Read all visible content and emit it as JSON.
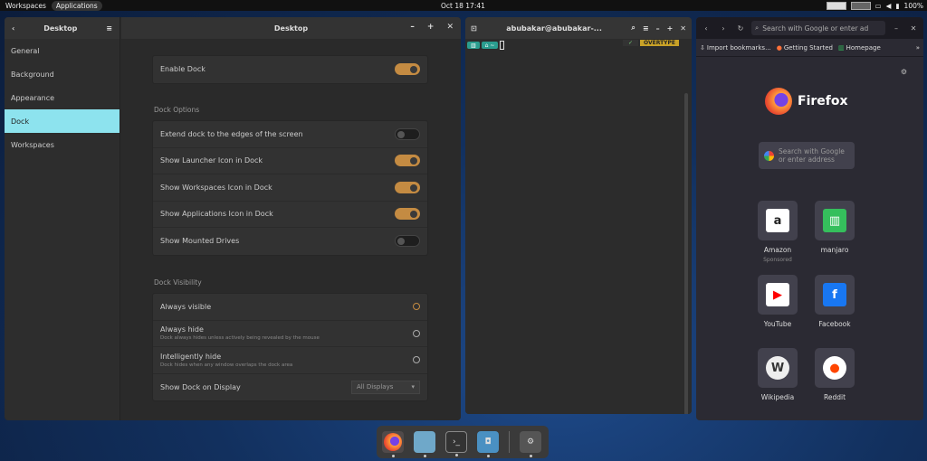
{
  "topbar": {
    "workspaces": "Workspaces",
    "applications": "Applications",
    "clock": "Oct 18  17:41",
    "battery": "100%"
  },
  "settings": {
    "sidebar_title": "Desktop",
    "sidebar": [
      "General",
      "Background",
      "Appearance",
      "Dock",
      "Workspaces"
    ],
    "title": "Desktop",
    "enable_dock": "Enable Dock",
    "dock_options_title": "Dock Options",
    "dock_options": [
      {
        "label": "Extend dock to the edges of the screen",
        "on": false
      },
      {
        "label": "Show Launcher Icon in Dock",
        "on": true
      },
      {
        "label": "Show Workspaces Icon in Dock",
        "on": true
      },
      {
        "label": "Show Applications Icon in Dock",
        "on": true
      },
      {
        "label": "Show Mounted Drives",
        "on": false
      }
    ],
    "visibility_title": "Dock Visibility",
    "always_visible": "Always visible",
    "always_hide": "Always hide",
    "always_hide_sub": "Dock always hides unless actively being revealed by the mouse",
    "intelligently_hide": "Intelligently hide",
    "intelligently_hide_sub": "Dock hides when any window overlaps the dock area",
    "show_on_display": "Show Dock on Display",
    "display_value": "All Displays"
  },
  "terminal": {
    "title": "abubakar@abubakar-...",
    "overtype": "OVERTYPE"
  },
  "firefox": {
    "url_placeholder": "Search with Google or enter ad",
    "bookmarks": [
      "Import bookmarks...",
      "Getting Started",
      "Homepage"
    ],
    "brand": "Firefox",
    "search_placeholder": "Search with Google or enter address",
    "tiles": [
      {
        "name": "Amazon",
        "sub": "Sponsored",
        "icon": "a",
        "color": "#fff",
        "fg": "#222"
      },
      {
        "name": "manjaro",
        "icon": "m",
        "color": "#35bf5c",
        "fg": "#fff"
      },
      {
        "name": "YouTube",
        "icon": "▶",
        "color": "#fff",
        "fg": "#f00"
      },
      {
        "name": "Facebook",
        "icon": "f",
        "color": "#1877f2",
        "fg": "#fff"
      },
      {
        "name": "Wikipedia",
        "icon": "W",
        "color": "#eee",
        "fg": "#333"
      },
      {
        "name": "Reddit",
        "icon": "●",
        "color": "#fff",
        "fg": "#ff4500"
      }
    ]
  }
}
